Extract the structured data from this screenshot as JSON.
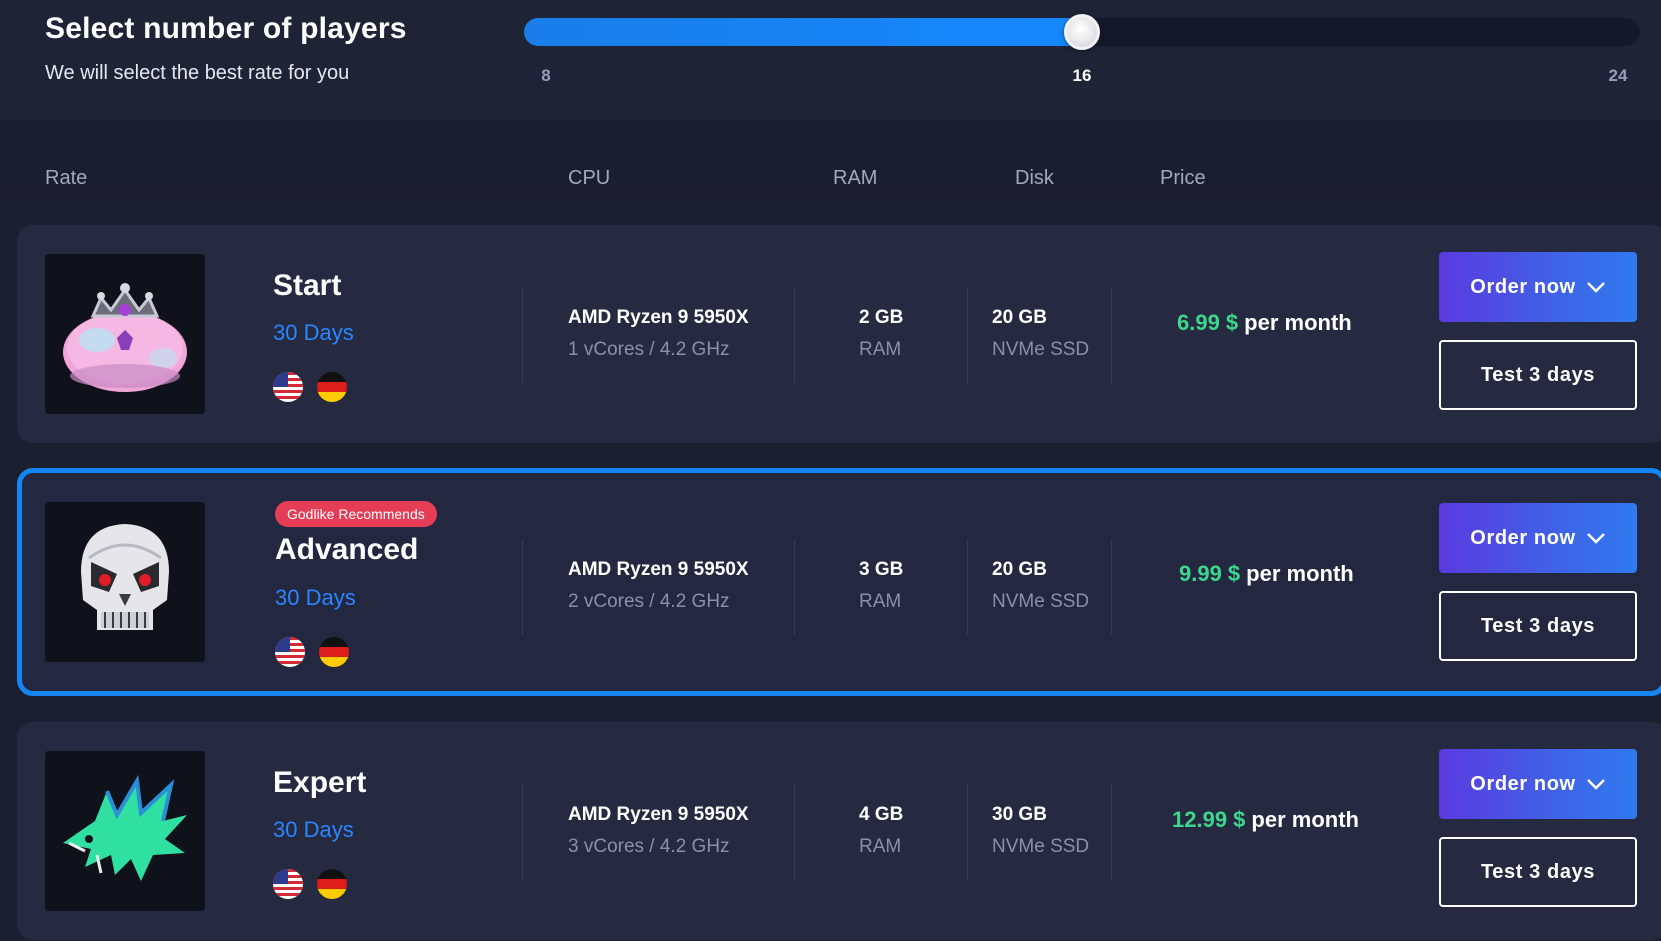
{
  "selector": {
    "title": "Select number of players",
    "subtitle": "We will select the best rate for you",
    "min": 8,
    "max": 24,
    "value": 16,
    "ticks": [
      "8",
      "16",
      "24"
    ]
  },
  "columns": {
    "rate": "Rate",
    "cpu": "CPU",
    "ram": "RAM",
    "disk": "Disk",
    "price": "Price"
  },
  "plans": [
    {
      "name": "Start",
      "days": "30 Days",
      "badge": "",
      "cpu_model": "AMD Ryzen 9 5950X",
      "cpu_detail": "1 vCores / 4.2 GHz",
      "ram_value": "2 GB",
      "ram_label": "RAM",
      "disk_value": "20 GB",
      "disk_label": "NVMe SSD",
      "price_amount": "6.99 $",
      "price_period": "per month",
      "order_label": "Order now",
      "test_label": "Test 3 days",
      "image_icon": "slime-queen-icon",
      "highlighted": false
    },
    {
      "name": "Advanced",
      "days": "30 Days",
      "badge": "Godlike Recommends",
      "cpu_model": "AMD Ryzen 9 5950X",
      "cpu_detail": "2 vCores / 4.2 GHz",
      "ram_value": "3 GB",
      "ram_label": "RAM",
      "disk_value": "20 GB",
      "disk_label": "NVMe SSD",
      "price_amount": "9.99 $",
      "price_period": "per month",
      "order_label": "Order now",
      "test_label": "Test 3 days",
      "image_icon": "skull-icon",
      "highlighted": true
    },
    {
      "name": "Expert",
      "days": "30 Days",
      "badge": "",
      "cpu_model": "AMD Ryzen 9 5950X",
      "cpu_detail": "3 vCores / 4.2 GHz",
      "ram_value": "4 GB",
      "ram_label": "RAM",
      "disk_value": "30 GB",
      "disk_label": "NVMe SSD",
      "price_amount": "12.99 $",
      "price_period": "per month",
      "order_label": "Order now",
      "test_label": "Test 3 days",
      "image_icon": "sea-dragon-icon",
      "highlighted": false
    }
  ],
  "flags": [
    "us-flag-icon",
    "de-flag-icon"
  ],
  "colors": {
    "background": "#1c1f30",
    "card": "#252a40",
    "accent_blue": "#1386f2",
    "price_green": "#3dd68c",
    "days_blue": "#2a86ff",
    "badge_red": "#e53d55",
    "order_gradient_start": "#5a3ae0",
    "order_gradient_end": "#2f7aee"
  }
}
